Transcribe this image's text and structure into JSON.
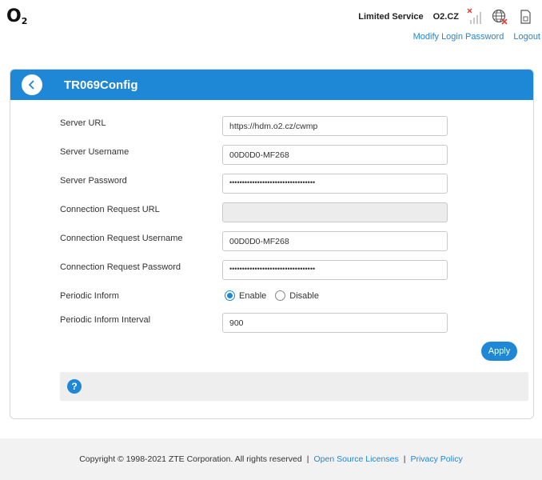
{
  "header": {
    "logo_main": "O",
    "logo_sub": "2",
    "service_status": "Limited Service",
    "operator": "O2.CZ",
    "links": {
      "modify_password": "Modify Login Password",
      "logout": "Logout"
    }
  },
  "panel": {
    "title": "TR069Config",
    "fields": {
      "server_url": {
        "label": "Server URL",
        "value": "https://hdm.o2.cz/cwmp"
      },
      "server_username": {
        "label": "Server Username",
        "value": "00D0D0-MF268"
      },
      "server_password": {
        "label": "Server Password",
        "value": "••••••••••••••••••••••••••••••••••"
      },
      "conn_req_url": {
        "label": "Connection Request URL",
        "value": ""
      },
      "conn_req_username": {
        "label": "Connection Request Username",
        "value": "00D0D0-MF268"
      },
      "conn_req_password": {
        "label": "Connection Request Password",
        "value": "••••••••••••••••••••••••••••••••••"
      },
      "periodic_inform": {
        "label": "Periodic Inform",
        "enable": "Enable",
        "disable": "Disable",
        "selected": "Enable"
      },
      "periodic_inform_interval": {
        "label": "Periodic Inform Interval",
        "value": "900"
      }
    },
    "apply_label": "Apply",
    "help_glyph": "?"
  },
  "footer": {
    "copyright": "Copyright © 1998-2021 ZTE Corporation. All rights reserved",
    "sep": "|",
    "open_source": "Open Source Licenses",
    "privacy": "Privacy Policy"
  },
  "colors": {
    "accent": "#1e87d6",
    "footer_bg": "#f2f2f2",
    "disabled_field": "#ececec",
    "error_red": "#e53935"
  }
}
